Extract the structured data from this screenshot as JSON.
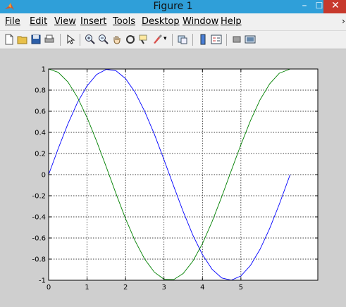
{
  "window": {
    "title": "Figure 1",
    "minimize": "–",
    "maximize": "☐",
    "close": "✕"
  },
  "menu": [
    {
      "label": "File"
    },
    {
      "label": "Edit"
    },
    {
      "label": "View"
    },
    {
      "label": "Insert"
    },
    {
      "label": "Tools"
    },
    {
      "label": "Desktop"
    },
    {
      "label": "Window"
    },
    {
      "label": "Help"
    }
  ],
  "toolbar": {
    "icons": [
      "new-figure-icon",
      "open-file-icon",
      "save-icon",
      "print-icon",
      "pointer-icon",
      "zoom-in-icon",
      "zoom-out-icon",
      "pan-icon",
      "rotate-3d-icon",
      "data-cursor-icon",
      "brush-icon",
      "link-plot-icon",
      "colorbar-icon",
      "legend-icon",
      "hide-plot-tools-icon",
      "show-plot-tools-icon"
    ]
  },
  "chart_data": {
    "type": "line",
    "title": "",
    "xlabel": "",
    "ylabel": "",
    "xlim": [
      0,
      7
    ],
    "ylim": [
      -1,
      1
    ],
    "grid": true,
    "grid_style": "dotted",
    "xticks": [
      0,
      1,
      2,
      3,
      4,
      5
    ],
    "xtick_labels": [
      "0",
      "1",
      "2",
      "3",
      "4",
      "5"
    ],
    "yticks": [
      -1,
      -0.8,
      -0.6,
      -0.4,
      -0.2,
      0,
      0.2,
      0.4,
      0.6,
      0.8,
      1
    ],
    "ytick_labels": [
      "-1",
      "-0.8",
      "-0.6",
      "-0.4",
      "-0.2",
      "0",
      "0.2",
      "0.4",
      "0.6",
      "0.8",
      "1"
    ],
    "series": [
      {
        "color": "#0000ff",
        "x": [
          0,
          0.25,
          0.5,
          0.75,
          1,
          1.25,
          1.5,
          1.75,
          2,
          2.25,
          2.5,
          2.75,
          3,
          3.25,
          3.5,
          3.75,
          4,
          4.25,
          4.5,
          4.75,
          5,
          5.25,
          5.5,
          5.75,
          6,
          6.28
        ],
        "y": [
          0,
          0.247,
          0.479,
          0.682,
          0.841,
          0.949,
          0.997,
          0.984,
          0.909,
          0.778,
          0.598,
          0.382,
          0.141,
          -0.108,
          -0.351,
          -0.572,
          -0.757,
          -0.895,
          -0.978,
          -0.999,
          -0.959,
          -0.859,
          -0.706,
          -0.508,
          -0.279,
          0
        ]
      },
      {
        "color": "#008000",
        "x": [
          0,
          0.25,
          0.5,
          0.75,
          1,
          1.25,
          1.5,
          1.75,
          2,
          2.25,
          2.5,
          2.75,
          3,
          3.25,
          3.5,
          3.75,
          4,
          4.25,
          4.5,
          4.75,
          5,
          5.25,
          5.5,
          5.75,
          6,
          6.28
        ],
        "y": [
          1,
          0.969,
          0.878,
          0.732,
          0.54,
          0.315,
          0.071,
          -0.178,
          -0.416,
          -0.628,
          -0.801,
          -0.924,
          -0.99,
          -0.994,
          -0.936,
          -0.82,
          -0.654,
          -0.446,
          -0.211,
          0.038,
          0.284,
          0.512,
          0.709,
          0.861,
          0.96,
          1
        ]
      }
    ]
  }
}
